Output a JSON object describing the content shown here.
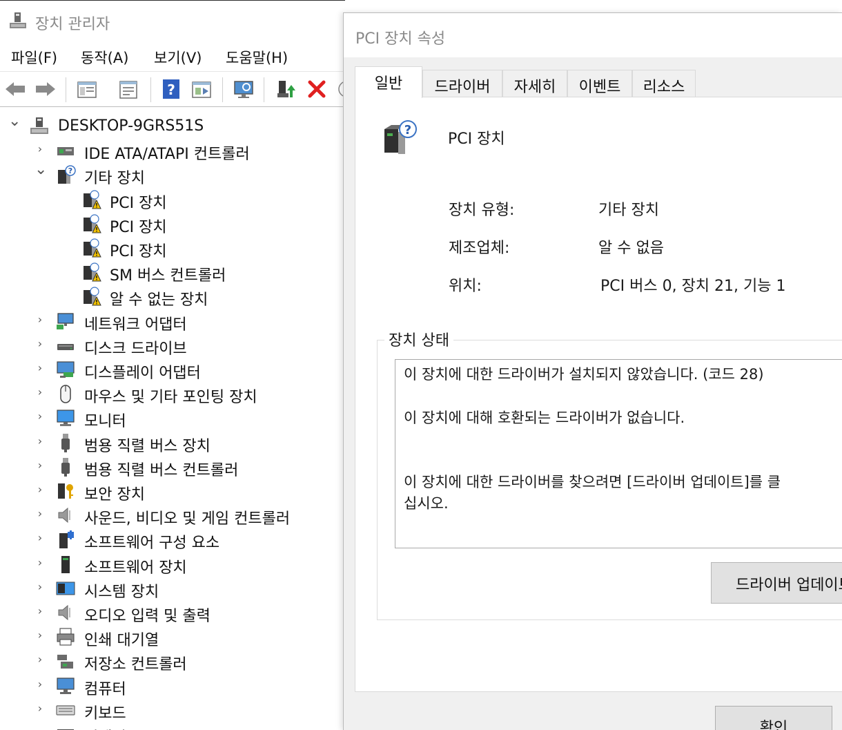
{
  "device_manager": {
    "title": "장치 관리자",
    "menu": [
      "파일(F)",
      "동작(A)",
      "보기(V)",
      "도움말(H)"
    ],
    "toolbar_icons": [
      "back-arrow-icon",
      "forward-arrow-icon",
      "show-hide-tree-icon",
      "properties-icon",
      "help-icon",
      "view-icon",
      "scan-hardware-icon",
      "update-driver-icon",
      "uninstall-icon"
    ],
    "tree": {
      "root": "DESKTOP-9GRS51S",
      "items": [
        {
          "label": "IDE ATA/ATAPI 컨트롤러",
          "icon": "ide-controller-icon",
          "expanded": false
        },
        {
          "label": "기타 장치",
          "icon": "unknown-device-icon",
          "expanded": true,
          "children": [
            {
              "label": "PCI 장치",
              "icon": "warning-device-icon"
            },
            {
              "label": "PCI 장치",
              "icon": "warning-device-icon"
            },
            {
              "label": "PCI 장치",
              "icon": "warning-device-icon"
            },
            {
              "label": "SM 버스 컨트롤러",
              "icon": "warning-device-icon"
            },
            {
              "label": "알 수 없는 장치",
              "icon": "warning-device-icon"
            }
          ]
        },
        {
          "label": "네트워크 어댑터",
          "icon": "network-adapter-icon",
          "expanded": false
        },
        {
          "label": "디스크 드라이브",
          "icon": "disk-drive-icon",
          "expanded": false
        },
        {
          "label": "디스플레이 어댑터",
          "icon": "display-adapter-icon",
          "expanded": false
        },
        {
          "label": "마우스 및 기타 포인팅 장치",
          "icon": "mouse-icon",
          "expanded": false
        },
        {
          "label": "모니터",
          "icon": "monitor-icon",
          "expanded": false
        },
        {
          "label": "범용 직렬 버스 장치",
          "icon": "usb-icon",
          "expanded": false
        },
        {
          "label": "범용 직렬 버스 컨트롤러",
          "icon": "usb-icon",
          "expanded": false
        },
        {
          "label": "보안 장치",
          "icon": "security-device-icon",
          "expanded": false
        },
        {
          "label": "사운드, 비디오 및 게임 컨트롤러",
          "icon": "speaker-icon",
          "expanded": false
        },
        {
          "label": "소프트웨어 구성 요소",
          "icon": "software-component-icon",
          "expanded": false
        },
        {
          "label": "소프트웨어 장치",
          "icon": "software-device-icon",
          "expanded": false
        },
        {
          "label": "시스템 장치",
          "icon": "system-device-icon",
          "expanded": false
        },
        {
          "label": "오디오 입력 및 출력",
          "icon": "speaker-icon",
          "expanded": false
        },
        {
          "label": "인쇄 대기열",
          "icon": "printer-icon",
          "expanded": false
        },
        {
          "label": "저장소 컨트롤러",
          "icon": "storage-controller-icon",
          "expanded": false
        },
        {
          "label": "컴퓨터",
          "icon": "computer-icon",
          "expanded": false
        },
        {
          "label": "키보드",
          "icon": "keyboard-icon",
          "expanded": false
        },
        {
          "label": "펌웨어",
          "icon": "firmware-icon",
          "expanded": false
        }
      ]
    }
  },
  "dialog": {
    "title": "PCI 장치 속성",
    "tabs": [
      "일반",
      "드라이버",
      "자세히",
      "이벤트",
      "리소스"
    ],
    "active_tab": "일반",
    "device_name": "PCI 장치",
    "properties": [
      {
        "key": "장치 유형:",
        "value": "기타 장치"
      },
      {
        "key": "제조업체:",
        "value": "알 수 없음"
      },
      {
        "key": "위치:",
        "value": "PCI 버스 0, 장치 21, 기능 1"
      }
    ],
    "status_group_label": "장치 상태",
    "status_lines": [
      "이 장치에 대한 드라이버가 설치되지 않았습니다. (코드 28)",
      "이 장치에 대해 호환되는 드라이버가 없습니다.",
      "이 장치에 대한 드라이버를 찾으려면 [드라이버 업데이트]를 클",
      "십시오."
    ],
    "update_driver_button": "드라이버 업데이트",
    "ok_button": "확인"
  }
}
